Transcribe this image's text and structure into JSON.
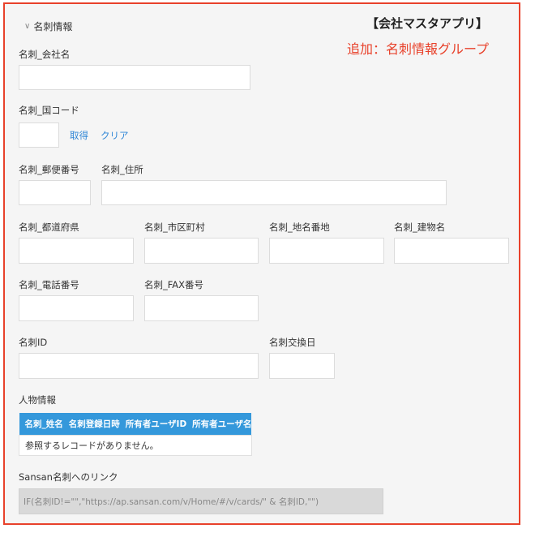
{
  "group": {
    "label": "名刺情報",
    "chevron_icon": "chevron-down-icon"
  },
  "app_title": "【会社マスタアプリ】",
  "annotation": "追加：名刺情報グループ",
  "fields": {
    "company_name": {
      "label": "名刺_会社名",
      "value": ""
    },
    "country_code": {
      "label": "名刺_国コード",
      "value": "",
      "fetch_label": "取得",
      "clear_label": "クリア"
    },
    "postal_code": {
      "label": "名刺_郵便番号",
      "value": ""
    },
    "address": {
      "label": "名刺_住所",
      "value": ""
    },
    "prefecture": {
      "label": "名刺_都道府県",
      "value": ""
    },
    "city": {
      "label": "名刺_市区町村",
      "value": ""
    },
    "street": {
      "label": "名刺_地名番地",
      "value": ""
    },
    "building": {
      "label": "名刺_建物名",
      "value": ""
    },
    "phone": {
      "label": "名刺_電話番号",
      "value": ""
    },
    "fax": {
      "label": "名刺_FAX番号",
      "value": ""
    },
    "card_id": {
      "label": "名刺ID",
      "value": ""
    },
    "exchange_date": {
      "label": "名刺交換日",
      "value": ""
    }
  },
  "people": {
    "label": "人物情報",
    "columns": [
      "名刺_姓名",
      "名刺登録日時",
      "所有者ユーザID",
      "所有者ユーザ名"
    ],
    "empty_message": "参照するレコードがありません。"
  },
  "sansan_link": {
    "label": "Sansan名刺へのリンク",
    "formula": "IF(名刺ID!=\"\",\"https://ap.sansan.com/v/Home/#/v/cards/\" & 名刺ID,\"\")"
  },
  "colors": {
    "frame_border": "#e8412a",
    "annotation": "#e8412a",
    "table_header": "#3498db",
    "link": "#2f86d6"
  }
}
